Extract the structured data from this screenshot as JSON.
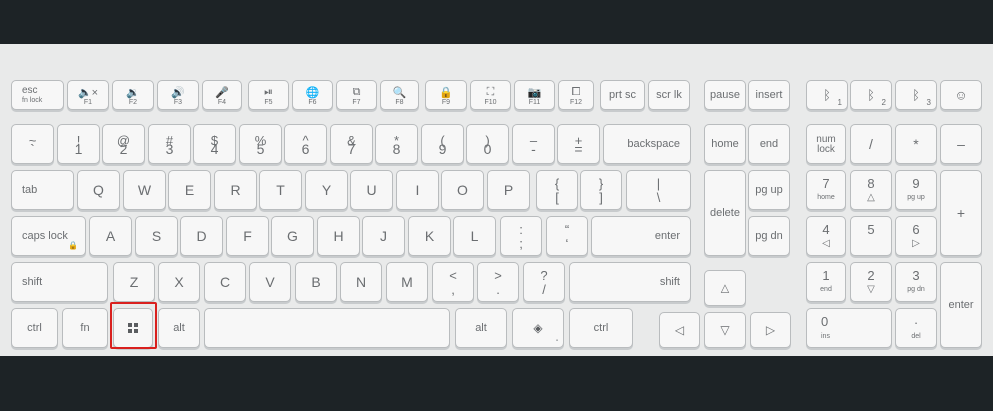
{
  "row_fn": {
    "esc": {
      "main": "esc",
      "sub": "fn lock"
    },
    "f1": {
      "icon": "🔈×",
      "label": "F1"
    },
    "f2": {
      "icon": "🔉",
      "label": "F2"
    },
    "f3": {
      "icon": "🔊",
      "label": "F3"
    },
    "f4": {
      "icon": "🎤",
      "label": "F4"
    },
    "f5": {
      "icon": "⏯",
      "label": "F5"
    },
    "f6": {
      "icon": "🌐",
      "label": "F6"
    },
    "f7": {
      "icon": "⧉",
      "label": "F7"
    },
    "f8": {
      "icon": "🔍",
      "label": "F8"
    },
    "f9": {
      "icon": "🔒",
      "label": "F9"
    },
    "f10": {
      "icon": "⛶",
      "label": "F10"
    },
    "f11": {
      "icon": "📷",
      "label": "F11"
    },
    "f12": {
      "icon": "⧠",
      "label": "F12"
    },
    "prtsc": "prt sc",
    "scrlk": "scr lk",
    "pause": "pause",
    "insert": "insert",
    "bt1": {
      "icon": "ᛒ",
      "num": "1"
    },
    "bt2": {
      "icon": "ᛒ",
      "num": "2"
    },
    "bt3": {
      "icon": "ᛒ",
      "num": "3"
    },
    "face": "☺"
  },
  "row_num": {
    "k1": [
      "~",
      "`"
    ],
    "k2": [
      "!",
      "1"
    ],
    "k3": [
      "@",
      "2"
    ],
    "k4": [
      "#",
      "3"
    ],
    "k5": [
      "$",
      "4"
    ],
    "k6": [
      "%",
      "5"
    ],
    "k7": [
      "^",
      "6"
    ],
    "k8": [
      "&",
      "7"
    ],
    "k9": [
      "*",
      "8"
    ],
    "k10": [
      "(",
      "9"
    ],
    "k11": [
      ")",
      "0"
    ],
    "k12": [
      "–",
      "-"
    ],
    "k13": [
      "+",
      "="
    ],
    "backspace": "backspace",
    "home": "home",
    "end": "end",
    "numlock": [
      "num",
      "lock"
    ],
    "npdiv": "/",
    "npmul": "*",
    "npminus": "–"
  },
  "row_q": {
    "tab": "tab",
    "letters": [
      "Q",
      "W",
      "E",
      "R",
      "T",
      "Y",
      "U",
      "I",
      "O",
      "P"
    ],
    "lbr": [
      "{",
      "["
    ],
    "rbr": [
      "}",
      "]"
    ],
    "pipe": [
      "|",
      "\\"
    ],
    "delete": "delete",
    "pgup": "pg up",
    "np7": [
      "7",
      "home"
    ],
    "np8": [
      "8",
      "△"
    ],
    "np9": [
      "9",
      "pg up"
    ],
    "npplus": "+"
  },
  "row_a": {
    "caps": "caps lock",
    "letters": [
      "A",
      "S",
      "D",
      "F",
      "G",
      "H",
      "J",
      "K",
      "L"
    ],
    "semi": [
      ":",
      ";"
    ],
    "quote": [
      "“",
      "‘"
    ],
    "enter": "enter",
    "pgdn": "pg dn",
    "np4": [
      "4",
      "◁"
    ],
    "np5": [
      "5",
      ""
    ],
    "np6": [
      "6",
      "▷"
    ]
  },
  "row_z": {
    "lshift": "shift",
    "letters": [
      "Z",
      "X",
      "C",
      "V",
      "B",
      "N",
      "M"
    ],
    "comma": [
      "<",
      ","
    ],
    "period": [
      ">",
      "."
    ],
    "slash": [
      "?",
      "/"
    ],
    "rshift": "shift",
    "up": "△",
    "np1": [
      "1",
      "end"
    ],
    "np2": [
      "2",
      "▽"
    ],
    "np3": [
      "3",
      "pg dn"
    ],
    "npenter": "enter"
  },
  "row_bottom": {
    "lctrl": "ctrl",
    "fn": "fn",
    "lalt": "alt",
    "ralt": "alt",
    "rctrl": "ctrl",
    "left": "◁",
    "down": "▽",
    "right": "▷",
    "np0": [
      "0",
      "ins"
    ],
    "npdot": [
      ".",
      "del"
    ]
  }
}
